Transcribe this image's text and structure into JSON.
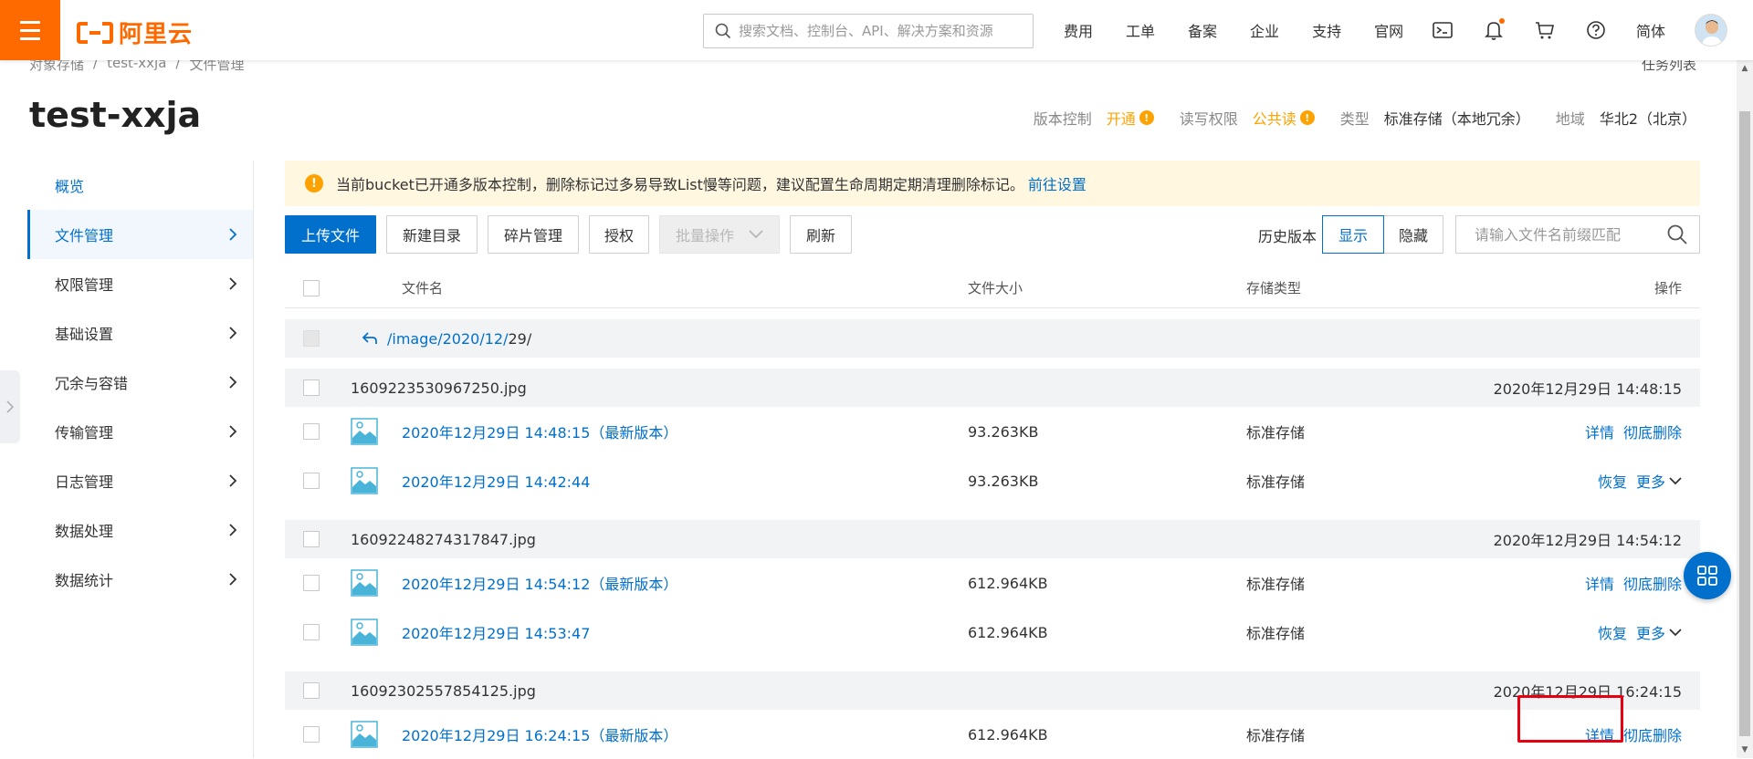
{
  "header": {
    "logo_text": "阿里云",
    "search_placeholder": "搜索文档、控制台、API、解决方案和资源",
    "nav": [
      "费用",
      "工单",
      "备案",
      "企业",
      "支持",
      "官网"
    ],
    "lang": "简体",
    "icons": [
      "terminal-icon",
      "bell-icon",
      "cart-icon",
      "help-icon"
    ]
  },
  "breadcrumb": [
    "对象存储",
    "test-xxja",
    "文件管理"
  ],
  "task_list": "任务列表",
  "bucket": {
    "title": "test-xxja",
    "versioning_label": "版本控制",
    "versioning_value": "开通",
    "acl_label": "读写权限",
    "acl_value": "公共读",
    "type_label": "类型",
    "type_value": "标准存储（本地冗余）",
    "region_label": "地域",
    "region_value": "华北2（北京）"
  },
  "sidebar": {
    "items": [
      {
        "label": "概览"
      },
      {
        "label": "文件管理"
      },
      {
        "label": "权限管理"
      },
      {
        "label": "基础设置"
      },
      {
        "label": "冗余与容错"
      },
      {
        "label": "传输管理"
      },
      {
        "label": "日志管理"
      },
      {
        "label": "数据处理"
      },
      {
        "label": "数据统计"
      }
    ]
  },
  "notice": {
    "text": "当前bucket已开通多版本控制，删除标记过多易导致List慢等问题，建议配置生命周期定期清理删除标记。",
    "link": "前往设置"
  },
  "toolbar": {
    "upload": "上传文件",
    "new_dir": "新建目录",
    "fragments": "碎片管理",
    "authorize": "授权",
    "batch": "批量操作",
    "refresh": "刷新",
    "history_label": "历史版本",
    "show": "显示",
    "hide": "隐藏",
    "filter_placeholder": "请输入文件名前缀匹配"
  },
  "table": {
    "headers": {
      "name": "文件名",
      "size": "文件大小",
      "type": "存储类型",
      "ops": "操作"
    },
    "path_prefix": "/image/2020/12/",
    "path_current": "29/",
    "groups": [
      {
        "name": "1609223530967250.jpg",
        "time": "2020年12月29日 14:48:15",
        "versions": [
          {
            "name": "2020年12月29日 14:48:15（最新版本）",
            "size": "93.263KB",
            "type": "标准存储",
            "op1": "详情",
            "op2": "彻底删除"
          },
          {
            "name": "2020年12月29日 14:42:44",
            "size": "93.263KB",
            "type": "标准存储",
            "op1": "恢复",
            "op2": "更多"
          }
        ]
      },
      {
        "name": "16092248274317847.jpg",
        "time": "2020年12月29日 14:54:12",
        "versions": [
          {
            "name": "2020年12月29日 14:54:12（最新版本）",
            "size": "612.964KB",
            "type": "标准存储",
            "op1": "详情",
            "op2": "彻底删除"
          },
          {
            "name": "2020年12月29日 14:53:47",
            "size": "612.964KB",
            "type": "标准存储",
            "op1": "恢复",
            "op2": "更多"
          }
        ]
      },
      {
        "name": "16092302557854125.jpg",
        "time": "2020年12月29日 16:24:15",
        "versions": [
          {
            "name": "2020年12月29日 16:24:15（最新版本）",
            "size": "612.964KB",
            "type": "标准存储",
            "op1": "详情",
            "op2": "彻底删除"
          }
        ]
      }
    ]
  },
  "colors": {
    "brand": "#ff6a00",
    "link": "#0070cc",
    "warning": "#ffa200",
    "highlight": "#e60012"
  }
}
